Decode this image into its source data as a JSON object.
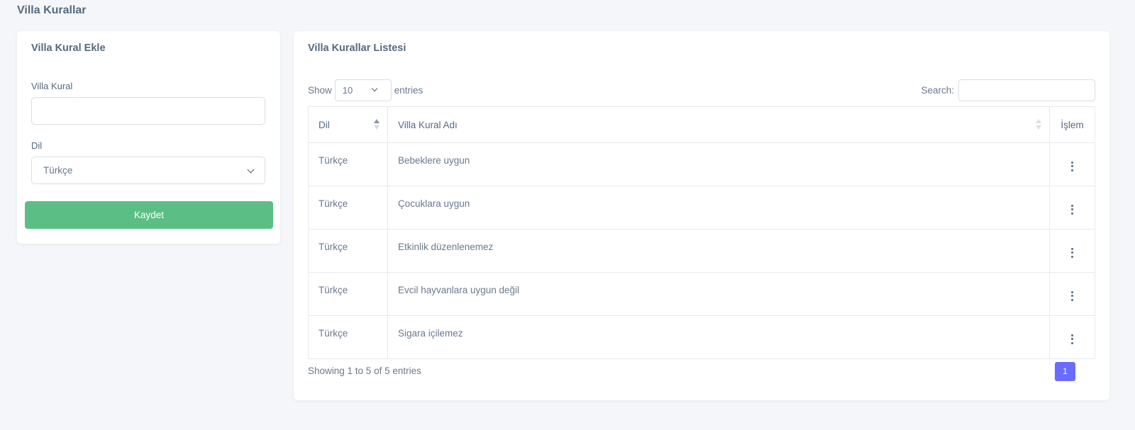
{
  "page": {
    "title": "Villa Kurallar"
  },
  "form": {
    "title": "Villa Kural Ekle",
    "rule_label": "Villa Kural",
    "rule_value": "",
    "lang_label": "Dil",
    "lang_selected": "Türkçe",
    "save_label": "Kaydet"
  },
  "list": {
    "title": "Villa Kurallar Listesi",
    "show_label": "Show",
    "page_length": "10",
    "entries_label": "entries",
    "search_label": "Search:",
    "search_value": "",
    "columns": [
      "Dil",
      "Villa Kural Adı",
      "İşlem"
    ],
    "rows": [
      {
        "dil": "Türkçe",
        "name": "Bebeklere uygun"
      },
      {
        "dil": "Türkçe",
        "name": "Çocuklara uygun"
      },
      {
        "dil": "Türkçe",
        "name": "Etkinlik düzenlenemez"
      },
      {
        "dil": "Türkçe",
        "name": "Evcil hayvanlara uygun değil"
      },
      {
        "dil": "Türkçe",
        "name": "Sigara içilemez"
      }
    ],
    "info": "Showing 1 to 5 of 5 entries",
    "current_page": "1"
  },
  "colors": {
    "save_button": "#5bbf85",
    "pagination_active": "#696cff",
    "background": "#f5f6f9"
  },
  "icons": {
    "select_arrow": "chevron-down-icon",
    "sort": "sort-icon",
    "row_actions": "more-vertical-icon"
  }
}
